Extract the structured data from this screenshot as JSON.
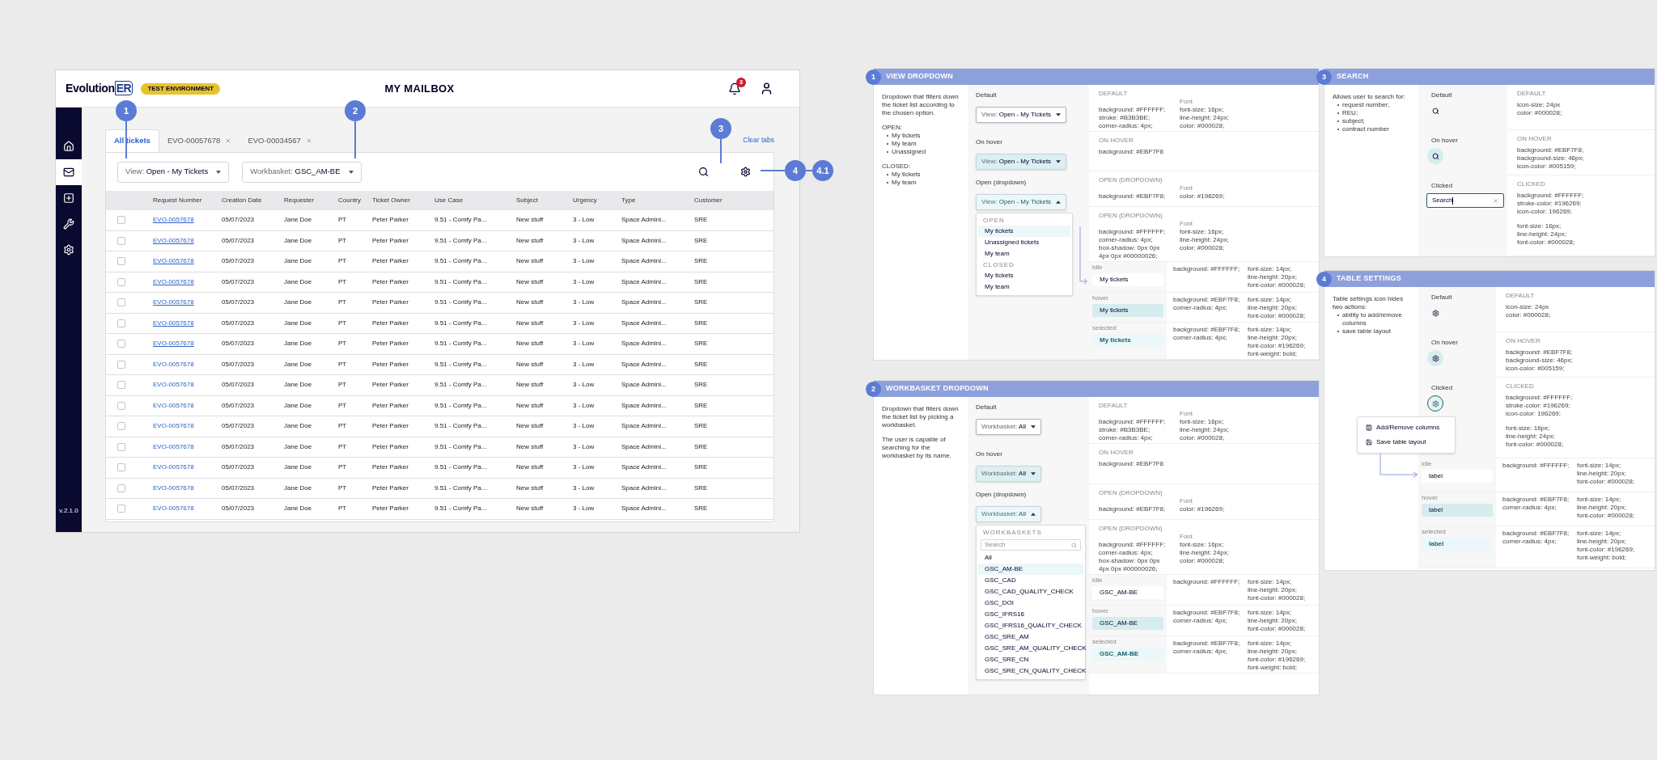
{
  "app": {
    "logo": {
      "text": "Evolution",
      "boxed": "ER"
    },
    "environment_badge": "TEST ENVIRONMENT",
    "title": "MY MAILBOX",
    "notification_count": "3",
    "sidebar": [
      {
        "kind": "home",
        "selected": false
      },
      {
        "kind": "mail",
        "selected": true
      },
      {
        "kind": "add",
        "selected": false
      },
      {
        "kind": "wrench",
        "selected": false
      },
      {
        "kind": "settings",
        "selected": false
      }
    ],
    "version": "v.2.1.0",
    "tabs": [
      {
        "label": "All tickets",
        "selected": true,
        "closable": false
      },
      {
        "label": "EVO-00057678",
        "selected": false,
        "closable": true
      },
      {
        "label": "EVO-00034567",
        "selected": false,
        "closable": true
      }
    ],
    "clear_tabs": "Clear tabs",
    "view_dropdown": {
      "label": "View:",
      "value": "Open - My Tickets"
    },
    "workbasket_dropdown": {
      "label": "Workbasket:",
      "value": "GSC_AM-BE"
    },
    "table": {
      "columns": [
        "Request Number",
        "Creation Date",
        "Requester",
        "Country",
        "Ticket Owner",
        "Use Case",
        "Subject",
        "Urgency",
        "Type",
        "Customer"
      ],
      "rows": [
        {
          "checked": false,
          "link_underlined": true,
          "cells": [
            "EVO-0057678",
            "05/07/2023",
            "Jane Doe",
            "PT",
            "Peter Parker",
            "9.51 - Comfy Pa...",
            "New stuff",
            "3 - Low",
            "Space Admini...",
            "SRE"
          ]
        },
        {
          "checked": false,
          "link_underlined": true,
          "cells": [
            "EVO-0057678",
            "05/07/2023",
            "Jane Doe",
            "PT",
            "Peter Parker",
            "9.51 - Comfy Pa...",
            "New stuff",
            "3 - Low",
            "Space Admini...",
            "SRE"
          ]
        },
        {
          "checked": false,
          "link_underlined": true,
          "cells": [
            "EVO-0057678",
            "05/07/2023",
            "Jane Doe",
            "PT",
            "Peter Parker",
            "9.51 - Comfy Pa...",
            "New stuff",
            "3 - Low",
            "Space Admini...",
            "SRE"
          ]
        },
        {
          "checked": false,
          "link_underlined": true,
          "cells": [
            "EVO-0057678",
            "05/07/2023",
            "Jane Doe",
            "PT",
            "Peter Parker",
            "9.51 - Comfy Pa...",
            "New stuff",
            "3 - Low",
            "Space Admini...",
            "SRE"
          ]
        },
        {
          "checked": false,
          "link_underlined": true,
          "cells": [
            "EVO-0057678",
            "05/07/2023",
            "Jane Doe",
            "PT",
            "Peter Parker",
            "9.51 - Comfy Pa...",
            "New stuff",
            "3 - Low",
            "Space Admini...",
            "SRE"
          ]
        },
        {
          "checked": false,
          "link_underlined": true,
          "cells": [
            "EVO-0057678",
            "05/07/2023",
            "Jane Doe",
            "PT",
            "Peter Parker",
            "9.51 - Comfy Pa...",
            "New stuff",
            "3 - Low",
            "Space Admini...",
            "SRE"
          ]
        },
        {
          "checked": false,
          "link_underlined": true,
          "cells": [
            "EVO-0057678",
            "05/07/2023",
            "Jane Doe",
            "PT",
            "Peter Parker",
            "9.51 - Comfy Pa...",
            "New stuff",
            "3 - Low",
            "Space Admini...",
            "SRE"
          ]
        },
        {
          "checked": false,
          "link_underlined": false,
          "cells": [
            "EVO-0057678",
            "05/07/2023",
            "Jane Doe",
            "PT",
            "Peter Parker",
            "9.51 - Comfy Pa...",
            "New stuff",
            "3 - Low",
            "Space Admini...",
            "SRE"
          ]
        },
        {
          "checked": false,
          "link_underlined": false,
          "cells": [
            "EVO-0057678",
            "05/07/2023",
            "Jane Doe",
            "PT",
            "Peter Parker",
            "9.51 - Comfy Pa...",
            "New stuff",
            "3 - Low",
            "Space Admini...",
            "SRE"
          ]
        },
        {
          "checked": false,
          "link_underlined": false,
          "cells": [
            "EVO-0057678",
            "05/07/2023",
            "Jane Doe",
            "PT",
            "Peter Parker",
            "9.51 - Comfy Pa...",
            "New stuff",
            "3 - Low",
            "Space Admini...",
            "SRE"
          ]
        },
        {
          "checked": false,
          "link_underlined": false,
          "cells": [
            "EVO-0057678",
            "05/07/2023",
            "Jane Doe",
            "PT",
            "Peter Parker",
            "9.51 - Comfy Pa...",
            "New stuff",
            "3 - Low",
            "Space Admini...",
            "SRE"
          ]
        },
        {
          "checked": false,
          "link_underlined": false,
          "cells": [
            "EVO-0057678",
            "05/07/2023",
            "Jane Doe",
            "PT",
            "Peter Parker",
            "9.51 - Comfy Pa...",
            "New stuff",
            "3 - Low",
            "Space Admini...",
            "SRE"
          ]
        },
        {
          "checked": false,
          "link_underlined": false,
          "cells": [
            "EVO-0057678",
            "05/07/2023",
            "Jane Doe",
            "PT",
            "Peter Parker",
            "9.51 - Comfy Pa...",
            "New stuff",
            "3 - Low",
            "Space Admini...",
            "SRE"
          ]
        },
        {
          "checked": false,
          "link_underlined": false,
          "cells": [
            "EVO-0057678",
            "05/07/2023",
            "Jane Doe",
            "PT",
            "Peter Parker",
            "9.51 - Comfy Pa...",
            "New stuff",
            "3 - Low",
            "Space Admini...",
            "SRE"
          ]
        },
        {
          "checked": false,
          "link_underlined": false,
          "cells": [
            "EVO-0057678",
            "05/07/2023",
            "Jane Doe",
            "PT",
            "Peter Parker",
            "9.51 - Comfy Pa...",
            "New stuff",
            "3 - Low",
            "Space Admini...",
            "SRE"
          ]
        }
      ]
    }
  },
  "callouts": [
    {
      "number": "1"
    },
    {
      "number": "2"
    },
    {
      "number": "3"
    },
    {
      "number": "4"
    },
    {
      "number": "4.1"
    }
  ],
  "spec_panels": [
    {
      "kind": "dropdown",
      "number": "1",
      "title": "VIEW DROPDOWN",
      "arrow": true,
      "description": [
        {
          "kind": "text",
          "text": "Dropdown that filters down the ticket list according to the chosen option."
        },
        {
          "kind": "list",
          "title": "OPEN:",
          "items": [
            "My tickets",
            "My team",
            "Unassigned"
          ]
        },
        {
          "kind": "list",
          "title": "CLOSED:",
          "items": [
            "My tickets",
            "My team"
          ]
        }
      ],
      "states": [
        {
          "label": "Default",
          "kind": "dropdown",
          "hovered": false,
          "open": false,
          "control": {
            "label": "View:",
            "value": "Open - My Tickets"
          }
        },
        {
          "label": "On hover",
          "kind": "dropdown",
          "hovered": true,
          "open": false,
          "control": {
            "label": "View:",
            "value": "Open - My Tickets"
          }
        },
        {
          "label": "Open (dropdown)",
          "kind": "dropdown",
          "hovered": false,
          "open": true,
          "control": {
            "label": "View:",
            "value": "Open - My Tickets"
          }
        }
      ],
      "menu": {
        "sections": [
          {
            "heading": "OPEN",
            "items": [
              {
                "text": "My tickets",
                "selected": true
              },
              {
                "text": "Unassigned tickets",
                "selected": false
              },
              {
                "text": "My team",
                "selected": false
              }
            ]
          },
          {
            "heading": "CLOSED",
            "items": [
              {
                "text": "My tickets",
                "selected": false
              },
              {
                "text": "My team",
                "selected": false
              }
            ]
          }
        ]
      },
      "spec_rows": [
        {
          "heading": "DEFAULT",
          "props": [
            "background: #FFFFFF;",
            "stroke: #B3B3BE;",
            "corner-radius: 4px;"
          ],
          "font_heading": "Font",
          "font_props": [
            "font-size: 16px;",
            "line-height: 24px;",
            "color: #000028;"
          ]
        },
        {
          "heading": "ON HOVER",
          "props": [
            "background: #EBF7F8"
          ]
        },
        {
          "heading": "OPEN (DROPDOWN)",
          "props": [
            "background: #EBF7F8;"
          ],
          "font_heading": "Font",
          "font_props": [
            "color: #196269;"
          ]
        },
        {
          "heading": "OPEN (DROPDOWN)",
          "props": [
            "background: #FFFFFF;",
            "corner-radius: 4px;",
            "box-shadow: 0px 0px",
            "4px 0px #00000026;"
          ],
          "font_heading": "Font",
          "font_props": [
            "font-size: 16px;",
            "line-height: 24px;",
            "color: #000028;"
          ]
        }
      ],
      "item_states": [
        {
          "label": "idle",
          "hovered": false,
          "selected": false,
          "sample": "My tickets",
          "props": [
            "background: #FFFFFF;"
          ],
          "font_props": [
            "font-size: 14px;",
            "line-height: 20px;",
            "font-color: #000028;"
          ]
        },
        {
          "label": "hover",
          "hovered": true,
          "selected": false,
          "sample": "My tickets",
          "props": [
            "background: #EBF7F8;",
            "corner-radius: 4px;"
          ],
          "font_props": [
            "font-size: 14px;",
            "line-height: 20px;",
            "font-color: #000028;"
          ]
        },
        {
          "label": "selected",
          "hovered": false,
          "selected": true,
          "sample": "My tickets",
          "props": [
            "background: #EBF7F8;",
            "corner-radius: 4px;"
          ],
          "font_props": [
            "font-size: 14px;",
            "line-height: 20px;",
            "font-color: #196269;",
            "font-weight: bold;"
          ]
        }
      ]
    },
    {
      "kind": "dropdown",
      "number": "2",
      "title": "WORKBASKET DROPDOWN",
      "arrow": false,
      "description": [
        {
          "kind": "text",
          "text": "Dropdown that filters down the ticket list by picking a workbasket."
        },
        {
          "kind": "text",
          "text": "The user is capable of searching for the workbasket by its name."
        }
      ],
      "states": [
        {
          "label": "Default",
          "kind": "dropdown",
          "hovered": false,
          "open": false,
          "control": {
            "label": "Workbasket:",
            "value": "All"
          }
        },
        {
          "label": "On hover",
          "kind": "dropdown",
          "hovered": true,
          "open": false,
          "control": {
            "label": "Workbasket:",
            "value": "All"
          }
        },
        {
          "label": "Open (dropdown)",
          "kind": "dropdown",
          "hovered": false,
          "open": true,
          "control": {
            "label": "Workbasket:",
            "value": "All"
          }
        }
      ],
      "menu": {
        "search_placeholder": "Search",
        "sections": [
          {
            "heading": "WORKBASKETS",
            "items": [
              {
                "text": "All",
                "selected": false
              },
              {
                "text": "GSC_AM-BE",
                "selected": true
              },
              {
                "text": "GSC_CAD",
                "selected": false
              },
              {
                "text": "GSC_CAD_QUALITY_CHECK",
                "selected": false
              },
              {
                "text": "GSC_DOI",
                "selected": false
              },
              {
                "text": "GSC_IFRS16",
                "selected": false
              },
              {
                "text": "GSC_IFRS16_QUALITY_CHECK",
                "selected": false
              },
              {
                "text": "GSC_SRE_AM",
                "selected": false
              },
              {
                "text": "GSC_SRE_AM_QUALITY_CHECK",
                "selected": false
              },
              {
                "text": "GSC_SRE_CN",
                "selected": false
              },
              {
                "text": "GSC_SRE_CN_QUALITY_CHECK",
                "selected": false
              }
            ]
          }
        ]
      },
      "spec_rows": [
        {
          "heading": "DEFAULT",
          "props": [
            "background: #FFFFFF;",
            "stroke: #B3B3BE;",
            "corner-radius: 4px;"
          ],
          "font_heading": "Font",
          "font_props": [
            "font-size: 16px;",
            "line-height: 24px;",
            "color: #000028;"
          ]
        },
        {
          "heading": "ON HOVER",
          "props": [
            "background: #EBF7F8"
          ]
        },
        {
          "heading": "OPEN (DROPDOWN)",
          "props": [
            "background: #EBF7F8;"
          ],
          "font_heading": "Font",
          "font_props": [
            "color: #196269;"
          ]
        },
        {
          "heading": "OPEN (DROPDOWN)",
          "props": [
            "background: #FFFFFF;",
            "corner-radius: 4px;",
            "box-shadow: 0px 0px",
            "4px 0px #00000026;"
          ],
          "font_heading": "Font",
          "font_props": [
            "font-size: 16px;",
            "line-height: 24px;",
            "color: #000028;"
          ]
        }
      ],
      "item_states": [
        {
          "label": "idle",
          "hovered": false,
          "selected": false,
          "sample": "GSC_AM-BE",
          "props": [
            "background: #FFFFFF;"
          ],
          "font_props": [
            "font-size: 14px;",
            "line-height: 20px;",
            "font-color: #000028;"
          ]
        },
        {
          "label": "hover",
          "hovered": true,
          "selected": false,
          "sample": "GSC_AM-BE",
          "props": [
            "background: #EBF7F8;",
            "corner-radius: 4px;"
          ],
          "font_props": [
            "font-size: 14px;",
            "line-height: 20px;",
            "font-color: #000028;"
          ]
        },
        {
          "label": "selected",
          "hovered": false,
          "selected": true,
          "sample": "GSC_AM-BE",
          "props": [
            "background: #EBF7F8;",
            "corner-radius: 4px;"
          ],
          "font_props": [
            "font-size: 14px;",
            "line-height: 20px;",
            "font-color: #196269;",
            "font-weight: bold;"
          ]
        }
      ]
    },
    {
      "kind": "search",
      "number": "3",
      "title": "SEARCH",
      "description": [
        {
          "kind": "list",
          "title": "Allows user to search for:",
          "items": [
            "request number;",
            "REU;",
            "subject;",
            "contract number"
          ]
        }
      ],
      "states": [
        {
          "label": "Default",
          "kind": "search",
          "hovered": false
        },
        {
          "label": "On hover",
          "kind": "search",
          "hovered": true
        },
        {
          "label": "Clicked",
          "kind": "field",
          "value": "Search"
        }
      ],
      "spec_rows": [
        {
          "heading": "DEFAULT",
          "props": [
            "icon-size: 24px",
            "color: #000028;"
          ]
        },
        {
          "heading": "ON HOVER",
          "props": [
            "background: #EBF7F8;",
            "background-size: 46px;",
            "icon-color: #005159;"
          ]
        },
        {
          "heading": "CLICKED",
          "props": [
            "background: #FFFFFF;",
            "stroke-color: #196269;",
            "icon-color: 196269;"
          ],
          "font_props": [
            "font-size: 16px;",
            "line-height: 24px;",
            "font-color: #000028;"
          ]
        }
      ]
    },
    {
      "kind": "settings",
      "number": "4",
      "title": "TABLE SETTINGS",
      "description": [
        {
          "kind": "list",
          "title": "Table settings icon hides two actions:",
          "items": [
            "ability to add/remove columns",
            "save table layout"
          ]
        }
      ],
      "states": [
        {
          "label": "Default",
          "kind": "gear",
          "hovered": false,
          "open": false
        },
        {
          "label": "On hover",
          "kind": "gear",
          "hovered": true,
          "open": false
        },
        {
          "label": "Clicked",
          "kind": "gear",
          "hovered": false,
          "open": true
        }
      ],
      "popup": [
        {
          "kind": "columns",
          "text": "Add/Remove columns"
        },
        {
          "kind": "save",
          "text": "Save table layout"
        }
      ],
      "spec_rows": [
        {
          "heading": "DEFAULT",
          "props": [
            "icon-size: 24px",
            "color: #000028;"
          ]
        },
        {
          "heading": "ON HOVER",
          "props": [
            "background: #EBF7F8;",
            "background-size: 46px;",
            "icon-color: #005159;"
          ]
        },
        {
          "heading": "CLICKED",
          "props": [
            "background: #FFFFFF;",
            "stroke-color: #196269;",
            "icon-color: 196269;"
          ],
          "font_props": [
            "font-size: 16px;",
            "line-height: 24px;",
            "font-color: #000028;"
          ]
        }
      ],
      "item_states": [
        {
          "label": "idle",
          "hovered": false,
          "selected": false,
          "sample": "label",
          "props": [
            "background: #FFFFFF;"
          ],
          "font_props": [
            "font-size: 14px;",
            "line-height: 20px;",
            "font-color: #000028;"
          ]
        },
        {
          "label": "hover",
          "hovered": true,
          "selected": false,
          "sample": "label",
          "props": [
            "background: #EBF7F8;",
            "corner-radius: 4px;"
          ],
          "font_props": [
            "font-size: 14px;",
            "line-height: 20px;",
            "font-color: #000028;"
          ]
        },
        {
          "label": "selected",
          "hovered": false,
          "selected": true,
          "sample": "label",
          "props": [
            "background: #EBF7F8;",
            "corner-radius: 4px;"
          ],
          "font_props": [
            "font-size: 14px;",
            "line-height: 20px;",
            "font-color: #196269;",
            "font-weight: bold;"
          ]
        }
      ]
    }
  ]
}
